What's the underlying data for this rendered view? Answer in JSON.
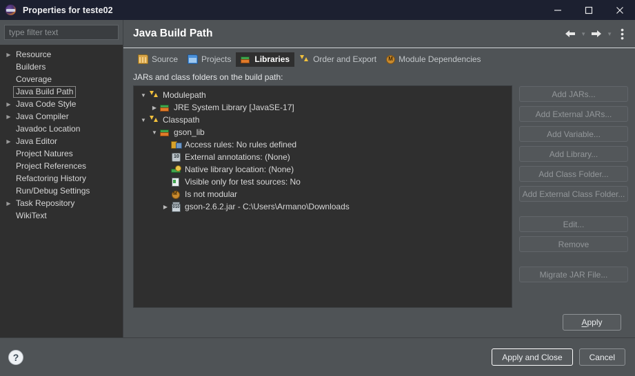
{
  "window": {
    "title": "Properties for teste02",
    "logo_icon": "eclipse-logo",
    "minimize_icon": "minimize-icon",
    "maximize_icon": "maximize-icon",
    "close_icon": "close-icon"
  },
  "sidebar": {
    "filter_placeholder": "type filter text",
    "filter_value": "",
    "items": [
      {
        "label": "Resource",
        "expandable": true,
        "selected": false
      },
      {
        "label": "Builders",
        "expandable": false,
        "selected": false
      },
      {
        "label": "Coverage",
        "expandable": false,
        "selected": false
      },
      {
        "label": "Java Build Path",
        "expandable": false,
        "selected": true
      },
      {
        "label": "Java Code Style",
        "expandable": true,
        "selected": false
      },
      {
        "label": "Java Compiler",
        "expandable": true,
        "selected": false
      },
      {
        "label": "Javadoc Location",
        "expandable": false,
        "selected": false
      },
      {
        "label": "Java Editor",
        "expandable": true,
        "selected": false
      },
      {
        "label": "Project Natures",
        "expandable": false,
        "selected": false
      },
      {
        "label": "Project References",
        "expandable": false,
        "selected": false
      },
      {
        "label": "Refactoring History",
        "expandable": false,
        "selected": false
      },
      {
        "label": "Run/Debug Settings",
        "expandable": false,
        "selected": false
      },
      {
        "label": "Task Repository",
        "expandable": true,
        "selected": false
      },
      {
        "label": "WikiText",
        "expandable": false,
        "selected": false
      }
    ]
  },
  "page": {
    "title": "Java Build Path",
    "toolbar": {
      "back_icon": "back-arrow-icon",
      "back_dropdown_icon": "chevron-down-icon",
      "forward_icon": "forward-arrow-icon",
      "forward_dropdown_icon": "chevron-down-icon",
      "menu_icon": "kebab-menu-icon"
    }
  },
  "tabs": [
    {
      "label": "Source",
      "icon": "source-folder-icon",
      "active": false
    },
    {
      "label": "Projects",
      "icon": "project-folder-icon",
      "active": false
    },
    {
      "label": "Libraries",
      "icon": "libraries-icon",
      "active": true
    },
    {
      "label": "Order and Export",
      "icon": "order-export-icon",
      "active": false
    },
    {
      "label": "Module Dependencies",
      "icon": "module-icon",
      "active": false
    }
  ],
  "content": {
    "label": "JARs and class folders on the build path:",
    "tree": [
      {
        "label": "Modulepath",
        "icon": "path-arrows-icon",
        "indent": 0,
        "twisty": "expanded"
      },
      {
        "label": "JRE System Library [JavaSE-17]",
        "icon": "library-icon",
        "indent": 1,
        "twisty": "collapsed"
      },
      {
        "label": "Classpath",
        "icon": "path-arrows-icon",
        "indent": 0,
        "twisty": "expanded"
      },
      {
        "label": "gson_lib",
        "icon": "library-icon",
        "indent": 1,
        "twisty": "expanded"
      },
      {
        "label": "Access rules: No rules defined",
        "icon": "access-rules-icon",
        "indent": 2,
        "twisty": "none"
      },
      {
        "label": "External annotations: (None)",
        "icon": "annotations-icon",
        "indent": 2,
        "twisty": "none"
      },
      {
        "label": "Native library location: (None)",
        "icon": "native-library-icon",
        "indent": 2,
        "twisty": "none"
      },
      {
        "label": "Visible only for test sources: No",
        "icon": "test-sources-icon",
        "indent": 2,
        "twisty": "none"
      },
      {
        "label": "Is not modular",
        "icon": "modular-icon",
        "indent": 2,
        "twisty": "none"
      },
      {
        "label": "gson-2.6.2.jar - C:\\Users\\Armano\\Downloads",
        "icon": "jar-icon",
        "indent": 2,
        "twisty": "collapsed"
      }
    ]
  },
  "side_buttons": [
    {
      "label": "Add JARs...",
      "enabled": false,
      "gap_after": false
    },
    {
      "label": "Add External JARs...",
      "enabled": false,
      "gap_after": false
    },
    {
      "label": "Add Variable...",
      "enabled": false,
      "gap_after": false
    },
    {
      "label": "Add Library...",
      "enabled": false,
      "gap_after": false
    },
    {
      "label": "Add Class Folder...",
      "enabled": false,
      "gap_after": false
    },
    {
      "label": "Add External Class Folder...",
      "enabled": false,
      "gap_after": true
    },
    {
      "label": "Edit...",
      "enabled": false,
      "gap_after": false
    },
    {
      "label": "Remove",
      "enabled": false,
      "gap_after": true
    },
    {
      "label": "Migrate JAR File...",
      "enabled": false,
      "gap_after": false
    }
  ],
  "apply": {
    "label": "Apply",
    "mnemonic": "A",
    "rest": "pply"
  },
  "footer": {
    "help_icon": "help-icon",
    "help_glyph": "?",
    "apply_and_close_label": "Apply and Close",
    "cancel_label": "Cancel"
  },
  "colors": {
    "titlebar": "#1c2030",
    "dialog_bg": "#4f5356",
    "tree_bg": "#2f2f2f",
    "text_primary": "#e8eaec",
    "text_disabled": "#93979a",
    "accent_yellow": "#f2c13d"
  }
}
